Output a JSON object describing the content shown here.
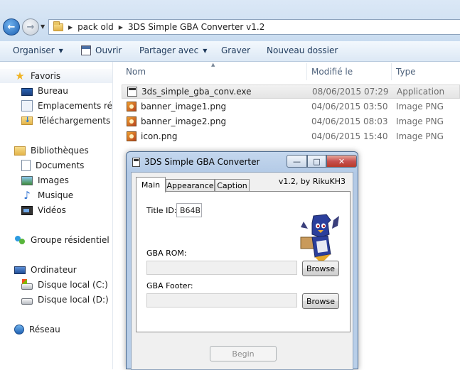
{
  "explorer": {
    "address": {
      "crumbs": [
        "pack old",
        "3DS Simple GBA Converter v1.2"
      ]
    },
    "toolbar": {
      "organize": "Organiser",
      "open": "Ouvrir",
      "share": "Partager avec",
      "burn": "Graver",
      "new_folder": "Nouveau dossier"
    },
    "nav": {
      "favorites": "Favoris",
      "desktop": "Bureau",
      "places": "Emplacements récen",
      "downloads": "Téléchargements",
      "libraries": "Bibliothèques",
      "documents": "Documents",
      "images": "Images",
      "music": "Musique",
      "videos": "Vidéos",
      "homegroup": "Groupe résidentiel",
      "computer": "Ordinateur",
      "disk_c": "Disque local (C:)",
      "disk_d": "Disque local (D:)",
      "network": "Réseau"
    },
    "columns": {
      "name": "Nom",
      "modified": "Modifié le",
      "type": "Type"
    },
    "files": [
      {
        "name": "3ds_simple_gba_conv.exe",
        "modified": "08/06/2015 07:29",
        "type": "Application"
      },
      {
        "name": "banner_image1.png",
        "modified": "04/06/2015 03:50",
        "type": "Image PNG"
      },
      {
        "name": "banner_image2.png",
        "modified": "04/06/2015 08:03",
        "type": "Image PNG"
      },
      {
        "name": "icon.png",
        "modified": "04/06/2015 15:40",
        "type": "Image PNG"
      }
    ]
  },
  "dialog": {
    "title": "3DS Simple GBA Converter",
    "version": "v1.2, by RikuKH3",
    "tabs": [
      "Main",
      "Appearance",
      "Caption"
    ],
    "title_id_label": "Title ID:",
    "title_id_value": "B64B",
    "gba_rom_label": "GBA ROM:",
    "gba_rom_value": "",
    "gba_footer_label": "GBA Footer:",
    "gba_footer_value": "",
    "browse_label": "Browse",
    "begin_label": "Begin"
  }
}
